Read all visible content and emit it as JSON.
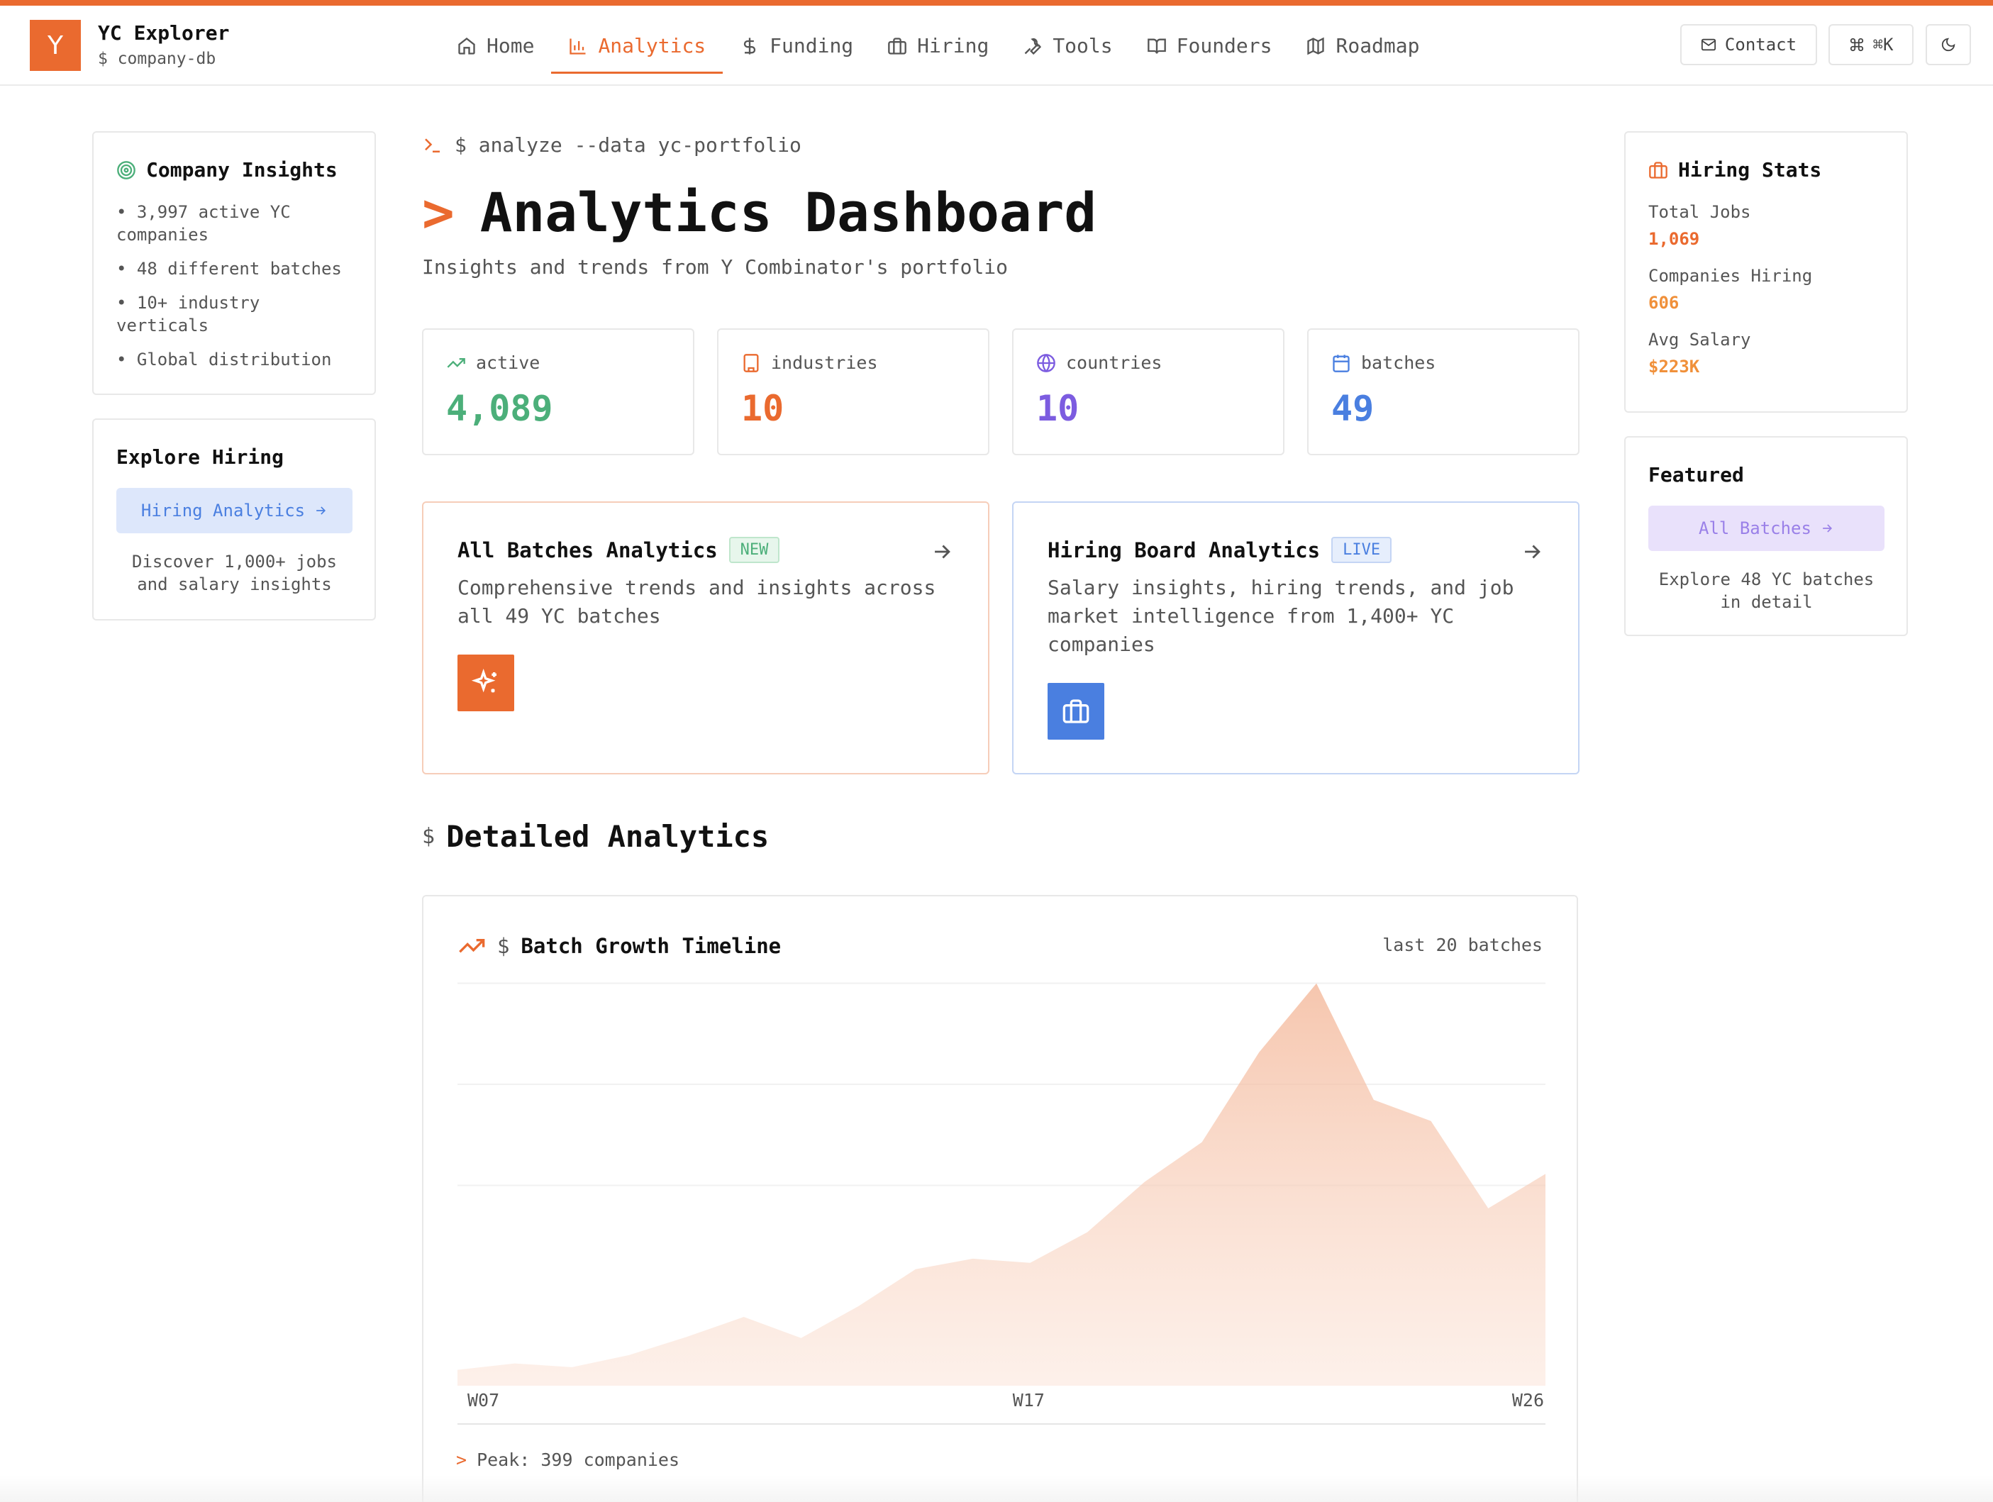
{
  "brand": {
    "logo_letter": "Y",
    "title": "YC Explorer",
    "subtitle": "$ company-db"
  },
  "nav": [
    {
      "label": "Home",
      "icon": "home-icon",
      "active": false
    },
    {
      "label": "Analytics",
      "icon": "bar-chart-icon",
      "active": true
    },
    {
      "label": "Funding",
      "icon": "dollar-icon",
      "active": false
    },
    {
      "label": "Hiring",
      "icon": "briefcase-icon",
      "active": false
    },
    {
      "label": "Tools",
      "icon": "wrench-icon",
      "active": false
    },
    {
      "label": "Founders",
      "icon": "book-open-icon",
      "active": false
    },
    {
      "label": "Roadmap",
      "icon": "map-icon",
      "active": false
    }
  ],
  "header_actions": {
    "contact": "Contact",
    "shortcut": "⌘K"
  },
  "left": {
    "insights_title": "Company Insights",
    "insights": [
      "• 3,997 active YC companies",
      "• 48 different batches",
      "• 10+ industry verticals",
      "• Global distribution"
    ],
    "explore_title": "Explore Hiring",
    "explore_button": "Hiring Analytics",
    "explore_note": "Discover 1,000+ jobs and salary insights"
  },
  "main": {
    "command": "$ analyze --data yc-portfolio",
    "title_prefix": ">",
    "title": "Analytics Dashboard",
    "subtitle": "Insights and trends from Y Combinator's portfolio"
  },
  "stats": [
    {
      "label": "active",
      "value": "4,089",
      "icon": "trending-up-icon",
      "color": "#4caf7a"
    },
    {
      "label": "industries",
      "value": "10",
      "icon": "building-icon",
      "color": "#ea6a2f"
    },
    {
      "label": "countries",
      "value": "10",
      "icon": "globe-icon",
      "color": "#7c5ce0"
    },
    {
      "label": "batches",
      "value": "49",
      "icon": "calendar-icon",
      "color": "#4a7fe0"
    }
  ],
  "features": [
    {
      "title": "All Batches Analytics",
      "badge": "NEW",
      "desc": "Comprehensive trends and insights across all 49 YC batches",
      "icon": "sparkles-icon"
    },
    {
      "title": "Hiring Board Analytics",
      "badge": "LIVE",
      "desc": "Salary insights, hiring trends, and job market intelligence from 1,400+ YC companies",
      "icon": "briefcase-icon"
    }
  ],
  "section": {
    "prefix": "$",
    "title": "Detailed Analytics"
  },
  "chart_data": {
    "type": "area",
    "title": "Batch Growth Timeline",
    "title_prefix": "$",
    "range_label": "last 20 batches",
    "x": [
      "W07",
      "",
      "",
      "",
      "",
      "",
      "",
      "",
      "",
      "",
      "W17",
      "",
      "",
      "",
      "",
      "",
      "",
      "",
      "",
      "W26"
    ],
    "values": [
      30,
      42,
      35,
      58,
      92,
      130,
      90,
      150,
      220,
      240,
      232,
      290,
      385,
      460,
      630,
      760,
      540,
      500,
      335,
      400
    ],
    "ylim": [
      0,
      420
    ],
    "peak_label": "Peak: 399 companies",
    "grid": true,
    "color": "#ea6a2f"
  },
  "right": {
    "hiring_title": "Hiring Stats",
    "stats": [
      {
        "label": "Total Jobs",
        "value": "1,069",
        "color": "#ea6a2f"
      },
      {
        "label": "Companies Hiring",
        "value": "606",
        "color": "#f0903a"
      },
      {
        "label": "Avg Salary",
        "value": "$223K",
        "color": "#f0903a"
      }
    ],
    "featured_title": "Featured",
    "featured_button": "All Batches",
    "featured_note": "Explore 48 YC batches in detail"
  }
}
